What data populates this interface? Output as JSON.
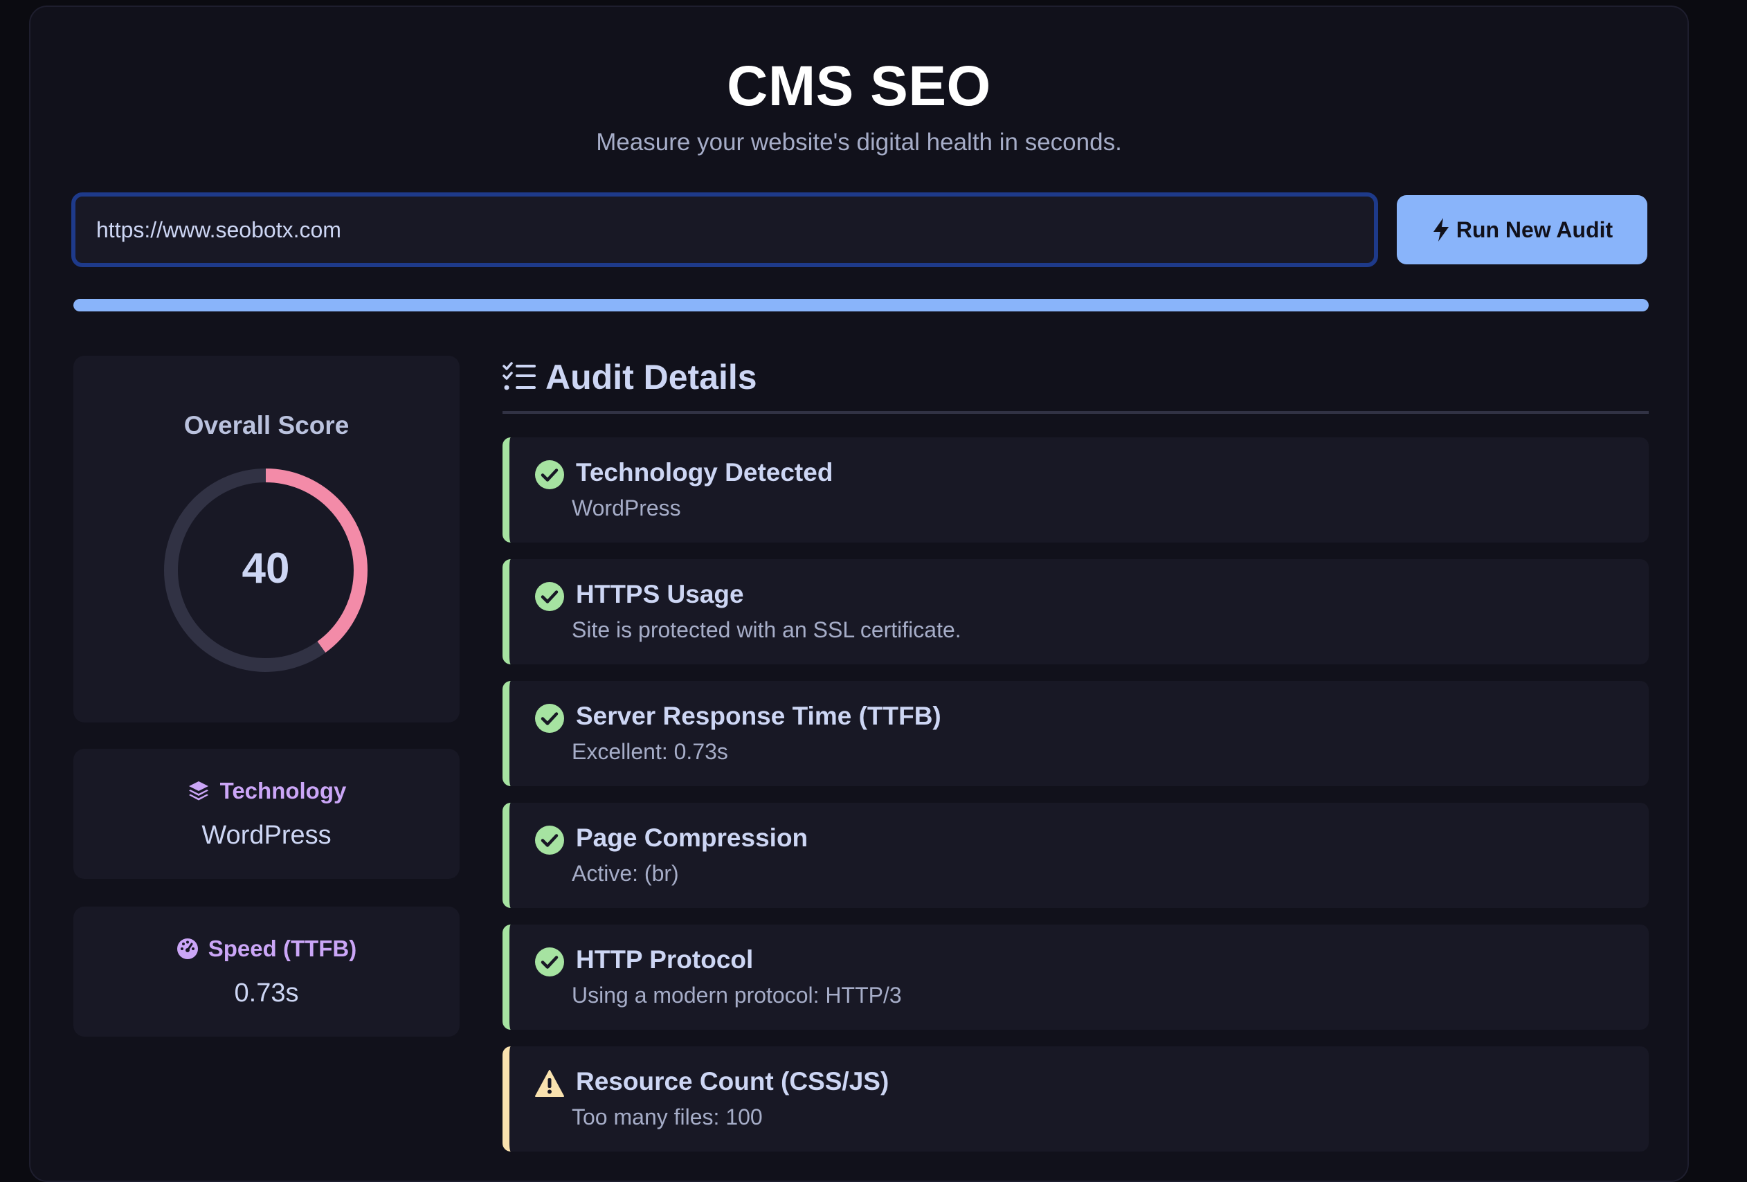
{
  "header": {
    "title": "CMS SEO",
    "subtitle": "Measure your website's digital health in seconds."
  },
  "search": {
    "value": "https://www.seobotx.com",
    "placeholder": ""
  },
  "run_button": {
    "label": "Run New Audit",
    "icon": "bolt-icon"
  },
  "progress": {
    "percent": 100
  },
  "score": {
    "label": "Overall Score",
    "value": 40,
    "max": 100,
    "color": "#f38ba8"
  },
  "stats": {
    "technology": {
      "label": "Technology",
      "value": "WordPress",
      "icon": "layers-icon"
    },
    "speed": {
      "label": "Speed (TTFB)",
      "value": "0.73s",
      "icon": "gauge-icon"
    }
  },
  "details": {
    "title": "Audit Details",
    "icon": "checklist-icon",
    "items": [
      {
        "title": "Technology Detected",
        "desc": "WordPress",
        "status": "pass",
        "icon": "check-circle-icon"
      },
      {
        "title": "HTTPS Usage",
        "desc": "Site is protected with an SSL certificate.",
        "status": "pass",
        "icon": "check-circle-icon"
      },
      {
        "title": "Server Response Time (TTFB)",
        "desc": "Excellent: 0.73s",
        "status": "pass",
        "icon": "check-circle-icon"
      },
      {
        "title": "Page Compression",
        "desc": "Active: (br)",
        "status": "pass",
        "icon": "check-circle-icon"
      },
      {
        "title": "HTTP Protocol",
        "desc": "Using a modern protocol: HTTP/3",
        "status": "pass",
        "icon": "check-circle-icon"
      },
      {
        "title": "Resource Count (CSS/JS)",
        "desc": "Too many files: 100",
        "status": "warn",
        "icon": "warning-icon"
      }
    ]
  },
  "colors": {
    "accent": "#89b4fa",
    "pass": "#a6e3a1",
    "warn": "#f9e2af",
    "score": "#f38ba8",
    "label": "#cba6f7"
  }
}
